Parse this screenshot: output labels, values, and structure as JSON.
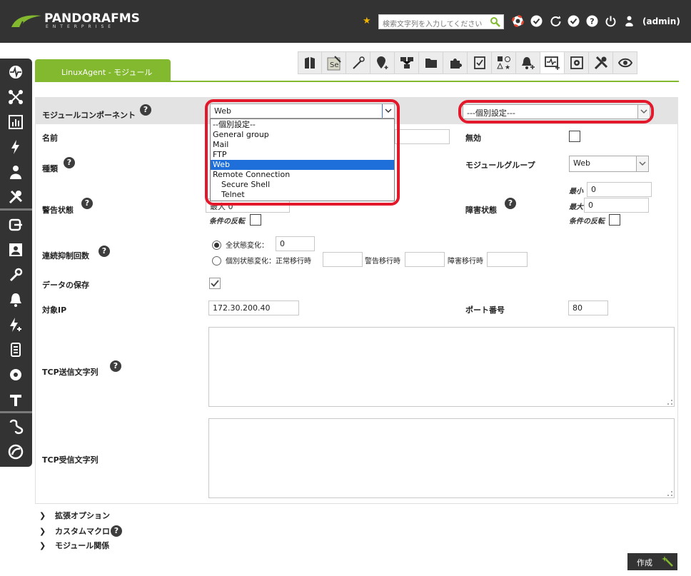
{
  "header": {
    "brand": "PANDORAFMS",
    "brand_sub": "ENTERPRISE",
    "search_placeholder": "検索文字列を入力してください",
    "user": "(admin)"
  },
  "tab": {
    "label": "LinuxAgent - モジュール"
  },
  "form": {
    "component_label": "モジュールコンポーネント",
    "component_value": "Web",
    "component_options": [
      "--個別設定--",
      "General group",
      "Mail",
      "FTP",
      "Web",
      "Remote Connection",
      "Secure Shell",
      "Telnet"
    ],
    "component_selected": "Web",
    "template_value": "---個別設定---",
    "name_label": "名前",
    "disabled_label": "無効",
    "type_label": "種類",
    "module_group_label": "モジュールグループ",
    "module_group_value": "Web",
    "warning_label": "警告状態",
    "warning_max_text": "最大 0",
    "invert_label": "条件の反転",
    "critical_label": "障害状態",
    "min_label": "最小",
    "min_value": "0",
    "max_label": "最大",
    "max_value": "0",
    "ff_label": "連続抑制回数",
    "ff_all_label": "全状態変化：",
    "ff_all_value": "0",
    "ff_each_label": "個別状態変化：正常移行時",
    "ff_warn_label": "警告移行時",
    "ff_crit_label": "障害移行時",
    "history_label": "データの保存",
    "target_ip_label": "対象IP",
    "target_ip_value": "172.30.200.40",
    "port_label": "ポート番号",
    "port_value": "80",
    "tcp_send_label": "TCP送信文字列",
    "tcp_recv_label": "TCP受信文字列"
  },
  "sections": {
    "advanced": "拡張オプション",
    "macros": "カスタムマクロ",
    "relations": "モジュール関係"
  },
  "actions": {
    "create": "作成"
  },
  "colors": {
    "accent": "#82b92e",
    "dark": "#333333",
    "highlight": "#e3182b",
    "selected": "#1e6fd9"
  }
}
